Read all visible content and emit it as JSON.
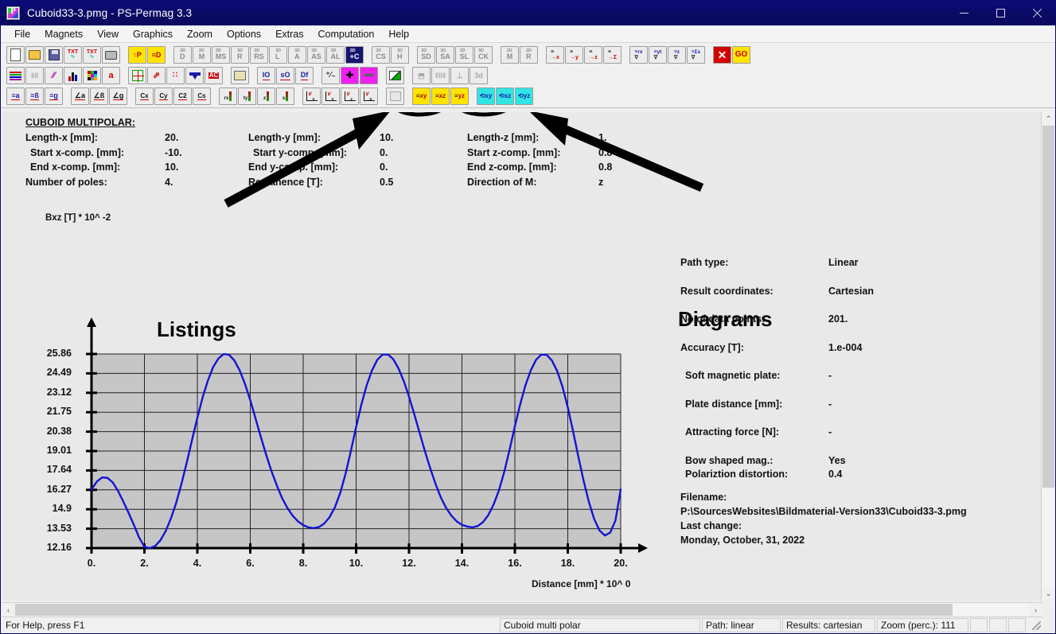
{
  "window": {
    "title": "Cuboid33-3.pmg - PS-Permag 3.3",
    "app_icon": "permag-icon",
    "minimize": "–",
    "maximize": "□",
    "close": "✕"
  },
  "menu": {
    "items": [
      {
        "label": "File"
      },
      {
        "label": "Magnets"
      },
      {
        "label": "View"
      },
      {
        "label": "Graphics"
      },
      {
        "label": "Zoom"
      },
      {
        "label": "Options"
      },
      {
        "label": "Extras"
      },
      {
        "label": "Computation"
      },
      {
        "label": "Help"
      }
    ]
  },
  "toolbar": {
    "row1": [
      {
        "name": "new-file-button",
        "kind": "page",
        "label": ""
      },
      {
        "name": "open-file-button",
        "kind": "folder",
        "label": ""
      },
      {
        "name": "save-file-button",
        "kind": "save",
        "label": ""
      },
      {
        "name": "export-txt-sine-button",
        "kind": "txt",
        "label": "TXT"
      },
      {
        "name": "export-txt-wave-button",
        "kind": "txt",
        "label": "TXT"
      },
      {
        "name": "print-button",
        "kind": "print",
        "label": ""
      },
      {
        "name": "gap",
        "kind": "gap",
        "label": ""
      },
      {
        "name": "parameters-up-button",
        "kind": "yellow",
        "label": "↑P"
      },
      {
        "name": "document-list-button",
        "kind": "yellow",
        "label": "≡D"
      },
      {
        "name": "gap",
        "kind": "gap",
        "label": ""
      },
      {
        "name": "magnet-3d-disc-button",
        "kind": "d3",
        "label": "D"
      },
      {
        "name": "magnet-3d-m-button",
        "kind": "d3",
        "label": "M"
      },
      {
        "name": "magnet-3d-ms-button",
        "kind": "d3",
        "label": "MS"
      },
      {
        "name": "magnet-3d-r-button",
        "kind": "d3",
        "label": "R"
      },
      {
        "name": "magnet-3d-rs-button",
        "kind": "d3",
        "label": "RS"
      },
      {
        "name": "magnet-3d-l-button",
        "kind": "d3",
        "label": "L"
      },
      {
        "name": "magnet-3d-a-button",
        "kind": "d3",
        "label": "A"
      },
      {
        "name": "magnet-3d-as-button",
        "kind": "d3",
        "label": "AS"
      },
      {
        "name": "magnet-3d-al-button",
        "kind": "d3",
        "label": "AL"
      },
      {
        "name": "magnet-3d-c-button",
        "kind": "d3sel",
        "label": "+C"
      },
      {
        "name": "gap",
        "kind": "gap",
        "label": ""
      },
      {
        "name": "magnet-3d-cs-button",
        "kind": "d3",
        "label": "CS"
      },
      {
        "name": "magnet-3d-h-button",
        "kind": "d3",
        "label": "H"
      },
      {
        "name": "gap",
        "kind": "gap",
        "label": ""
      },
      {
        "name": "magnet-3d-sd-button",
        "kind": "d3",
        "label": "SD"
      },
      {
        "name": "magnet-3d-sa-button",
        "kind": "d3",
        "label": "SA"
      },
      {
        "name": "magnet-3d-sl-button",
        "kind": "d3",
        "label": "SL"
      },
      {
        "name": "magnet-3d-ck-button",
        "kind": "d3",
        "label": "CK"
      },
      {
        "name": "gap",
        "kind": "gap",
        "label": ""
      },
      {
        "name": "magnet-2d-m-button",
        "kind": "d2",
        "label": "M"
      },
      {
        "name": "magnet-2d-r-button",
        "kind": "d2",
        "label": "R"
      },
      {
        "name": "gap",
        "kind": "gap",
        "label": ""
      },
      {
        "name": "path-rx-button",
        "kind": "arrow",
        "label": "→x"
      },
      {
        "name": "path-ty-button",
        "kind": "arrow",
        "label": "→y"
      },
      {
        "name": "path-z-button",
        "kind": "arrow",
        "label": "→z"
      },
      {
        "name": "path-sum-button",
        "kind": "arrow",
        "label": "→Σ"
      },
      {
        "name": "gap",
        "kind": "gap",
        "label": ""
      },
      {
        "name": "graph-rxy-button",
        "kind": "graph",
        "label": "rx"
      },
      {
        "name": "graph-yty-button",
        "kind": "graph",
        "label": "yt"
      },
      {
        "name": "graph-z-button",
        "kind": "graph",
        "label": "z"
      },
      {
        "name": "graph-sigma-button",
        "kind": "graph",
        "label": "Σs"
      },
      {
        "name": "gap",
        "kind": "gap",
        "label": ""
      },
      {
        "name": "stop-computation-button",
        "kind": "red-x",
        "label": "✕"
      },
      {
        "name": "go-computation-button",
        "kind": "go",
        "label": "GO"
      }
    ],
    "row2": [
      {
        "name": "color-bars-button",
        "kind": "colorbars",
        "label": ""
      },
      {
        "name": "grid-columns-button",
        "kind": "disabled",
        "label": "‖‖"
      },
      {
        "name": "line-style-button",
        "kind": "lines",
        "label": "∕∕"
      },
      {
        "name": "bar-chart-button",
        "kind": "barchart",
        "label": ""
      },
      {
        "name": "palette-button",
        "kind": "palette",
        "label": ""
      },
      {
        "name": "text-format-button",
        "kind": "textfmt",
        "label": "a"
      },
      {
        "name": "gap",
        "kind": "gap",
        "label": ""
      },
      {
        "name": "crosshair-button",
        "kind": "cross",
        "label": ""
      },
      {
        "name": "vectors-button",
        "kind": "vectors",
        "label": ""
      },
      {
        "name": "points-button",
        "kind": "points",
        "label": ""
      },
      {
        "name": "magnet-top-button",
        "kind": "tmag",
        "label": ""
      },
      {
        "name": "autocolor-button",
        "kind": "ac",
        "label": "AC"
      },
      {
        "name": "gap",
        "kind": "gap",
        "label": ""
      },
      {
        "name": "table-button",
        "kind": "table",
        "label": ""
      },
      {
        "name": "gap",
        "kind": "gap",
        "label": ""
      },
      {
        "name": "io-button",
        "kind": "uline",
        "label": "IO"
      },
      {
        "name": "so-button",
        "kind": "uline",
        "label": "sO"
      },
      {
        "name": "df-button",
        "kind": "uline",
        "label": "Df"
      },
      {
        "name": "gap",
        "kind": "gap",
        "label": ""
      },
      {
        "name": "plus-minus-button",
        "kind": "plain",
        "label": "⁺⁄₋"
      },
      {
        "name": "add-button",
        "kind": "magenta",
        "label": "✚"
      },
      {
        "name": "subtract-button",
        "kind": "magenta",
        "label": "➖"
      },
      {
        "name": "gap",
        "kind": "gap",
        "label": ""
      },
      {
        "name": "diagram-style-button",
        "kind": "diagstyle",
        "label": ""
      },
      {
        "name": "gap",
        "kind": "gap",
        "label": ""
      },
      {
        "name": "extrude-button",
        "kind": "disabled",
        "label": "⬒"
      },
      {
        "name": "columns-button",
        "kind": "disabled",
        "label": "‖‖‖"
      },
      {
        "name": "align-button",
        "kind": "disabled",
        "label": "⊥"
      },
      {
        "name": "threed-plot-button",
        "kind": "disabled",
        "label": "3d"
      }
    ],
    "row3": [
      {
        "name": "list-a-button",
        "kind": "lista",
        "label": "a"
      },
      {
        "name": "list-beta-button",
        "kind": "lista",
        "label": "ß"
      },
      {
        "name": "list-g-button",
        "kind": "lista",
        "label": "g"
      },
      {
        "name": "gap",
        "kind": "gap",
        "label": ""
      },
      {
        "name": "curve-a-button",
        "kind": "curvea",
        "label": "a"
      },
      {
        "name": "curve-beta-button",
        "kind": "curvea",
        "label": "ß"
      },
      {
        "name": "curve-g-button",
        "kind": "curvea",
        "label": "g"
      },
      {
        "name": "gap",
        "kind": "gap",
        "label": ""
      },
      {
        "name": "contour-cx-button",
        "kind": "cx",
        "label": "Cx"
      },
      {
        "name": "contour-cy-button",
        "kind": "cx",
        "label": "Cy"
      },
      {
        "name": "contour-c2-button",
        "kind": "cx",
        "label": "C2"
      },
      {
        "name": "contour-cs-button",
        "kind": "cx",
        "label": "Cs"
      },
      {
        "name": "gap",
        "kind": "gap",
        "label": ""
      },
      {
        "name": "colorgraph-rx-button",
        "kind": "cgraph",
        "label": "rx"
      },
      {
        "name": "colorgraph-ty-button",
        "kind": "cgraph",
        "label": "ty"
      },
      {
        "name": "colorgraph-z-button",
        "kind": "cgraph",
        "label": "z"
      },
      {
        "name": "colorgraph-s-button",
        "kind": "cgraph",
        "label": "s"
      },
      {
        "name": "gap",
        "kind": "gap",
        "label": ""
      },
      {
        "name": "plotxy-x-button",
        "kind": "plotxy",
        "label": "x"
      },
      {
        "name": "plotxy-y-button",
        "kind": "plotxy",
        "label": "y"
      },
      {
        "name": "plotxy-z-button",
        "kind": "plotxy",
        "label": "z"
      },
      {
        "name": "plotxy-s-button",
        "kind": "plotxy",
        "label": "s"
      },
      {
        "name": "gap",
        "kind": "gap",
        "label": ""
      },
      {
        "name": "surface-plot-button",
        "kind": "disabled-surface",
        "label": ""
      },
      {
        "name": "gap",
        "kind": "gap",
        "label": ""
      },
      {
        "name": "listing-xy-button",
        "kind": "yellow-plane",
        "label": "xy"
      },
      {
        "name": "listing-xz-button",
        "kind": "yellow-plane",
        "label": "xz"
      },
      {
        "name": "listing-yz-button",
        "kind": "yellow-plane",
        "label": "yz"
      },
      {
        "name": "gap",
        "kind": "gap",
        "label": ""
      },
      {
        "name": "diagram-xy-button",
        "kind": "cyan-plane",
        "label": "xy"
      },
      {
        "name": "diagram-xz-button",
        "kind": "cyan-plane",
        "label": "xz"
      },
      {
        "name": "diagram-yz-button",
        "kind": "cyan-plane",
        "label": "yz"
      }
    ]
  },
  "annotations": {
    "listings": "Listings",
    "diagrams": "Diagrams"
  },
  "parameters": {
    "heading": "CUBOID MULTIPOLAR:",
    "rows": [
      {
        "label_x": "Length-x [mm]:",
        "value_x": "20.",
        "label_y": "Length-y [mm]:",
        "value_y": "10.",
        "label_z": "Length-z [mm]:",
        "value_z": "1."
      },
      {
        "label_x": "Start x-comp. [mm]:",
        "value_x": "-10.",
        "label_y": "Start y-comp. [mm]:",
        "value_y": "0.",
        "label_z": "Start z-comp. [mm]:",
        "value_z": "0.8"
      },
      {
        "label_x": "End x-comp. [mm]:",
        "value_x": "10.",
        "label_y": "End y-comp. [mm]:",
        "value_y": "0.",
        "label_z": "End z-comp. [mm]:",
        "value_z": "0.8"
      },
      {
        "label_x": "Number of poles:",
        "value_x": "4.",
        "label_y": "Remanence [T]:",
        "value_y": "0.5",
        "label_z": "Direction of M:",
        "value_z": "z"
      }
    ]
  },
  "info_panel": {
    "rows": [
      {
        "label": "Path type:",
        "value": "Linear"
      },
      {
        "label": "Result coordinates:",
        "value": "Cartesian"
      },
      {
        "label": "No.of data points:",
        "value": "201."
      },
      {
        "label": "Accuracy [T]:",
        "value": "1.e-004"
      },
      {
        "label": "Soft magnetic plate:",
        "value": "-"
      },
      {
        "label": "Plate distance [mm]:",
        "value": "-"
      },
      {
        "label": "Attracting force [N]:",
        "value": "-"
      }
    ],
    "bow_label": "Bow shaped mag.:",
    "bow_value": "Yes",
    "polar_label": "Polariztion distortion:",
    "polar_value": "0.4",
    "filename_label": "Filename:",
    "filename_value": "P:\\SourcesWebsites\\Bildmaterial-Version33\\Cuboid33-3.pmg",
    "lastchange_label": "Last change:",
    "lastchange_value": "Monday, October, 31, 2022"
  },
  "chart_data": {
    "type": "line",
    "title": "",
    "ylabel": "Bxz [T] * 10^ -2",
    "xlabel": "Distance [mm] * 10^ 0",
    "xlim": [
      0,
      20
    ],
    "ylim": [
      12.16,
      25.86
    ],
    "grid": true,
    "legend": "none",
    "line_color": "#1414d2",
    "plot_bg": "#c6c6c6",
    "xticks": [
      "0.",
      "2.",
      "4.",
      "6.",
      "8.",
      "10.",
      "12.",
      "14.",
      "16.",
      "18.",
      "20."
    ],
    "xtick_values": [
      0,
      2,
      4,
      6,
      8,
      10,
      12,
      14,
      16,
      18,
      20
    ],
    "yticks": [
      "25.86",
      "24.49",
      "23.12",
      "21.75",
      "20.38",
      "19.01",
      "17.64",
      "16.27",
      "14.9",
      "13.53",
      "12.16"
    ],
    "ytick_values": [
      25.86,
      24.49,
      23.12,
      21.75,
      20.38,
      19.01,
      17.64,
      16.27,
      14.9,
      13.53,
      12.16
    ],
    "series": [
      {
        "name": "Bxz",
        "x": [
          0.0,
          0.2,
          0.4,
          0.6,
          0.8,
          1.0,
          1.2,
          1.4,
          1.6,
          1.8,
          2.0,
          2.2,
          2.4,
          2.6,
          2.8,
          3.0,
          3.2,
          3.4,
          3.6,
          3.8,
          4.0,
          4.2,
          4.4,
          4.6,
          4.8,
          5.0,
          5.2,
          5.4,
          5.6,
          5.8,
          6.0,
          6.2,
          6.4,
          6.6,
          6.8,
          7.0,
          7.2,
          7.4,
          7.6,
          7.8,
          8.0,
          8.2,
          8.4,
          8.6,
          8.8,
          9.0,
          9.2,
          9.4,
          9.6,
          9.8,
          10.0,
          10.2,
          10.4,
          10.6,
          10.8,
          11.0,
          11.2,
          11.4,
          11.6,
          11.8,
          12.0,
          12.2,
          12.4,
          12.6,
          12.8,
          13.0,
          13.2,
          13.4,
          13.6,
          13.8,
          14.0,
          14.2,
          14.4,
          14.6,
          14.8,
          15.0,
          15.2,
          15.4,
          15.6,
          15.8,
          16.0,
          16.2,
          16.4,
          16.6,
          16.8,
          17.0,
          17.2,
          17.4,
          17.6,
          17.8,
          18.0,
          18.2,
          18.4,
          18.6,
          18.8,
          19.0,
          19.2,
          19.4,
          19.6,
          19.8,
          20.0
        ],
        "y": [
          16.3,
          16.85,
          17.15,
          17.12,
          16.8,
          16.2,
          15.45,
          14.65,
          13.8,
          12.9,
          12.25,
          12.16,
          12.3,
          12.7,
          13.35,
          14.25,
          15.35,
          16.7,
          18.2,
          19.8,
          21.35,
          22.8,
          24.0,
          24.95,
          25.55,
          25.86,
          25.8,
          25.4,
          24.7,
          23.75,
          22.6,
          21.3,
          20.0,
          18.75,
          17.6,
          16.6,
          15.7,
          15.0,
          14.45,
          14.05,
          13.78,
          13.62,
          13.57,
          13.65,
          13.9,
          14.35,
          15.05,
          16.05,
          17.4,
          19.0,
          20.7,
          22.3,
          23.65,
          24.7,
          25.45,
          25.82,
          25.83,
          25.5,
          24.85,
          23.95,
          22.85,
          21.6,
          20.3,
          19.0,
          17.8,
          16.7,
          15.75,
          15.0,
          14.45,
          14.05,
          13.8,
          13.68,
          13.62,
          13.72,
          14.0,
          14.5,
          15.25,
          16.25,
          17.55,
          19.1,
          20.75,
          22.3,
          23.65,
          24.7,
          25.45,
          25.82,
          25.8,
          25.4,
          24.65,
          23.55,
          22.1,
          20.4,
          18.6,
          16.9,
          15.4,
          14.2,
          13.4,
          13.05,
          13.25,
          14.1,
          16.3
        ]
      }
    ]
  },
  "statusbar": {
    "help": "For Help, press F1",
    "panes": [
      "Cuboid multi polar",
      "Path: linear",
      "Results: cartesian",
      "Zoom (perc.): 111"
    ]
  },
  "scroll": {
    "up_arrow": "⌃",
    "down_arrow": "⌄",
    "left_arrow": "‹",
    "right_arrow": "›"
  }
}
